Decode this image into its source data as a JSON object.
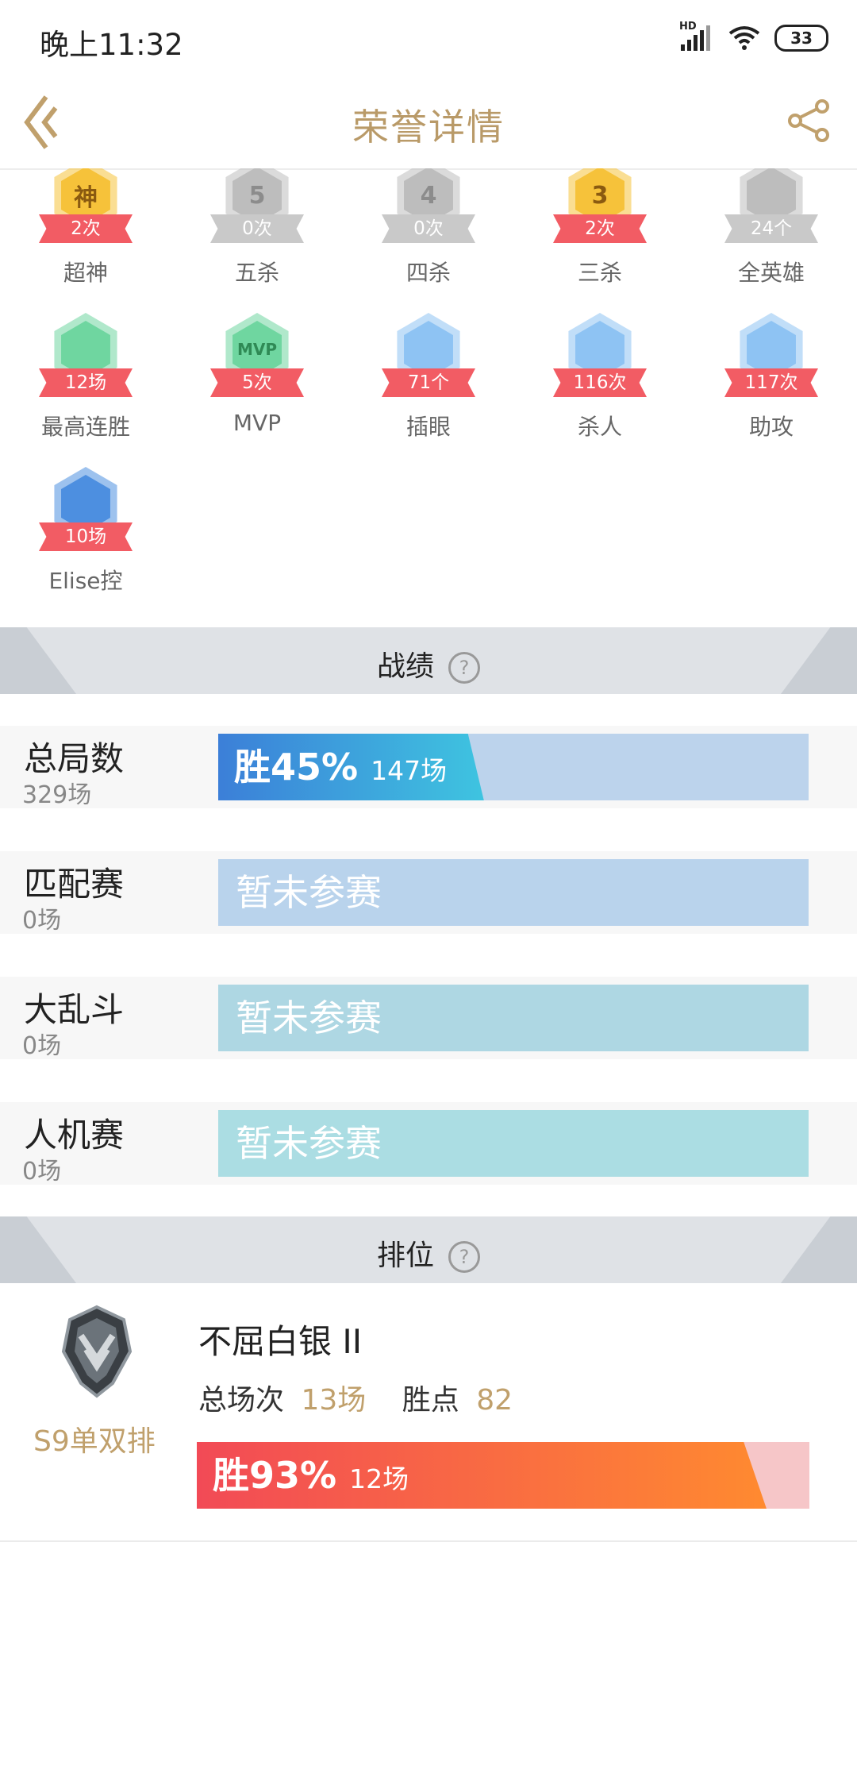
{
  "status_bar": {
    "time": "晚上11:32",
    "battery": "33",
    "network_tag": "HD"
  },
  "nav": {
    "title": "荣誉详情",
    "back_icon": "chevron-left-icon",
    "share_icon": "share-icon"
  },
  "honors": [
    {
      "label": "超神",
      "value": "2次",
      "icon": "god-badge-icon",
      "color": "#f6c23a",
      "active": true,
      "glyph": "神"
    },
    {
      "label": "五杀",
      "value": "0次",
      "icon": "penta-kill-icon",
      "color": "#bdbdbd",
      "active": false,
      "glyph": "5"
    },
    {
      "label": "四杀",
      "value": "0次",
      "icon": "quadra-kill-icon",
      "color": "#bdbdbd",
      "active": false,
      "glyph": "4"
    },
    {
      "label": "三杀",
      "value": "2次",
      "icon": "triple-kill-icon",
      "color": "#f6c23a",
      "active": true,
      "glyph": "3"
    },
    {
      "label": "全英雄",
      "value": "24个",
      "icon": "all-heroes-icon",
      "color": "#bdbdbd",
      "active": false,
      "glyph": ""
    },
    {
      "label": "最高连胜",
      "value": "12场",
      "icon": "trophy-icon",
      "color": "#6fd6a0",
      "active": true,
      "glyph": ""
    },
    {
      "label": "MVP",
      "value": "5次",
      "icon": "mvp-icon",
      "color": "#6fd6a0",
      "active": true,
      "glyph": "MVP"
    },
    {
      "label": "插眼",
      "value": "71个",
      "icon": "ward-icon",
      "color": "#8ec3f3",
      "active": true,
      "glyph": ""
    },
    {
      "label": "杀人",
      "value": "116次",
      "icon": "kill-icon",
      "color": "#8ec3f3",
      "active": true,
      "glyph": ""
    },
    {
      "label": "助攻",
      "value": "117次",
      "icon": "assist-icon",
      "color": "#8ec3f3",
      "active": true,
      "glyph": ""
    },
    {
      "label": "Elise控",
      "value": "10场",
      "icon": "elise-champion-icon",
      "color": "#4d8fe0",
      "active": true,
      "glyph": ""
    }
  ],
  "record_section": {
    "title": "战绩",
    "help_icon": "question-icon"
  },
  "stats": [
    {
      "name": "总局数",
      "count": "329场",
      "win_label": "胜45%",
      "win_games": "147场",
      "win_rate": 0.45,
      "bar_color": "#bcd3ec"
    },
    {
      "name": "匹配赛",
      "count": "0场",
      "empty_text": "暂未参赛",
      "bar_color": "#b9d3ec"
    },
    {
      "name": "大乱斗",
      "count": "0场",
      "empty_text": "暂未参赛",
      "bar_color": "#aed7e3"
    },
    {
      "name": "人机赛",
      "count": "0场",
      "empty_text": "暂未参赛",
      "bar_color": "#abdde3"
    }
  ],
  "rank_section": {
    "title": "排位",
    "help_icon": "question-icon",
    "rank_name": "不屈白银 II",
    "total_label": "总场次",
    "total_value": "13场",
    "points_label": "胜点",
    "points_value": "82",
    "season": "S9单双排",
    "win_label": "胜93%",
    "win_games": "12场",
    "win_rate": 0.93,
    "emblem_icon": "silver-rank-emblem-icon"
  }
}
